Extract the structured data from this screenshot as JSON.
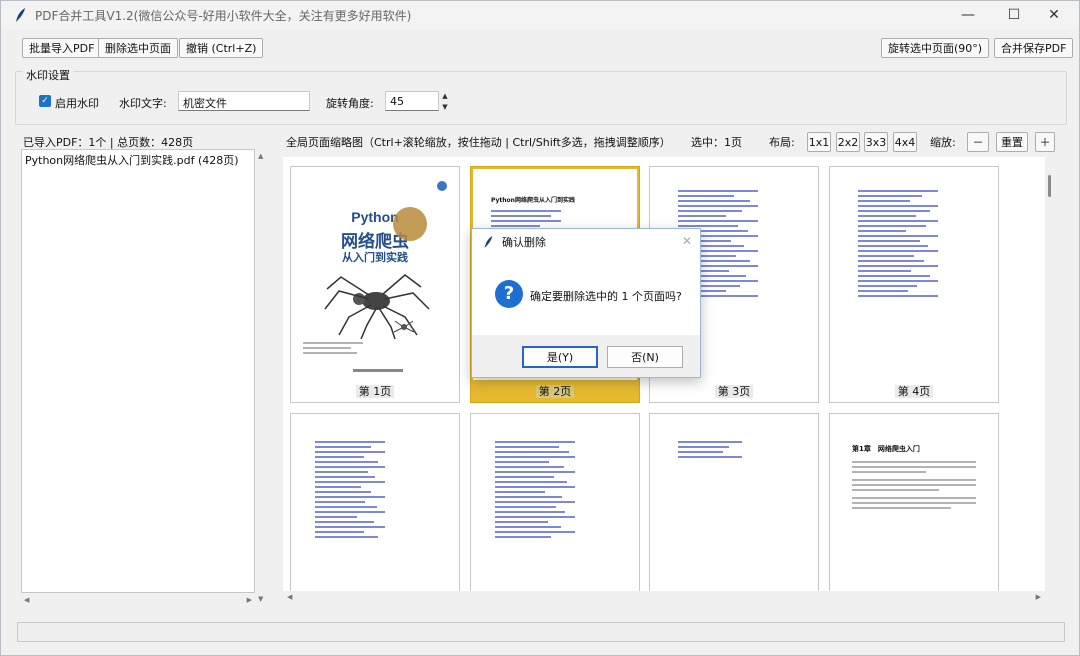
{
  "window": {
    "title": "PDF合并工具V1.2(微信公众号-好用小软件大全，关注有更多好用软件)"
  },
  "toolbar": {
    "batch_import": "批量导入PDF",
    "delete_selected": "删除选中页面",
    "undo": "撤销 (Ctrl+Z)",
    "rotate_selected": "旋转选中页面(90°)",
    "merge_save": "合并保存PDF"
  },
  "watermark": {
    "group_title": "水印设置",
    "enable_label": "启用水印",
    "enabled": true,
    "text_label": "水印文字:",
    "text_value": "机密文件",
    "angle_label": "旋转角度:",
    "angle_value": "45"
  },
  "files": {
    "summary": "已导入PDF：1个 | 总页数：428页",
    "items": [
      "Python网络爬虫从入门到实践.pdf (428页)"
    ]
  },
  "preview": {
    "hint": "全局页面缩略图（Ctrl+滚轮缩放，按住拖动 | Ctrl/Shift多选，拖拽调整顺序）",
    "selected": "选中：1页",
    "layout_label": "布局:",
    "layouts": [
      "1x1",
      "2x2",
      "3x3",
      "4x4"
    ],
    "zoom_label": "缩放:",
    "zoom_minus": "－",
    "zoom_reset": "重置",
    "zoom_plus": "＋"
  },
  "pages": [
    {
      "label": "第 1页",
      "selected": false
    },
    {
      "label": "第 2页",
      "selected": true
    },
    {
      "label": "第 3页",
      "selected": false
    },
    {
      "label": "第 4页",
      "selected": false
    }
  ],
  "cover": {
    "title_en": "Python",
    "title_cn": "网络爬虫",
    "subtitle": "从入门到实践"
  },
  "toc": {
    "title": "Python网络爬虫从入门到实践"
  },
  "chapter1": {
    "title": "第1章　网络爬虫入门"
  },
  "dialog": {
    "title": "确认删除",
    "message": "确定要删除选中的 1 个页面吗?",
    "yes": "是(Y)",
    "no": "否(N)"
  },
  "colors": {
    "accent": "#1a73c8",
    "selected_page": "#e5b930"
  }
}
